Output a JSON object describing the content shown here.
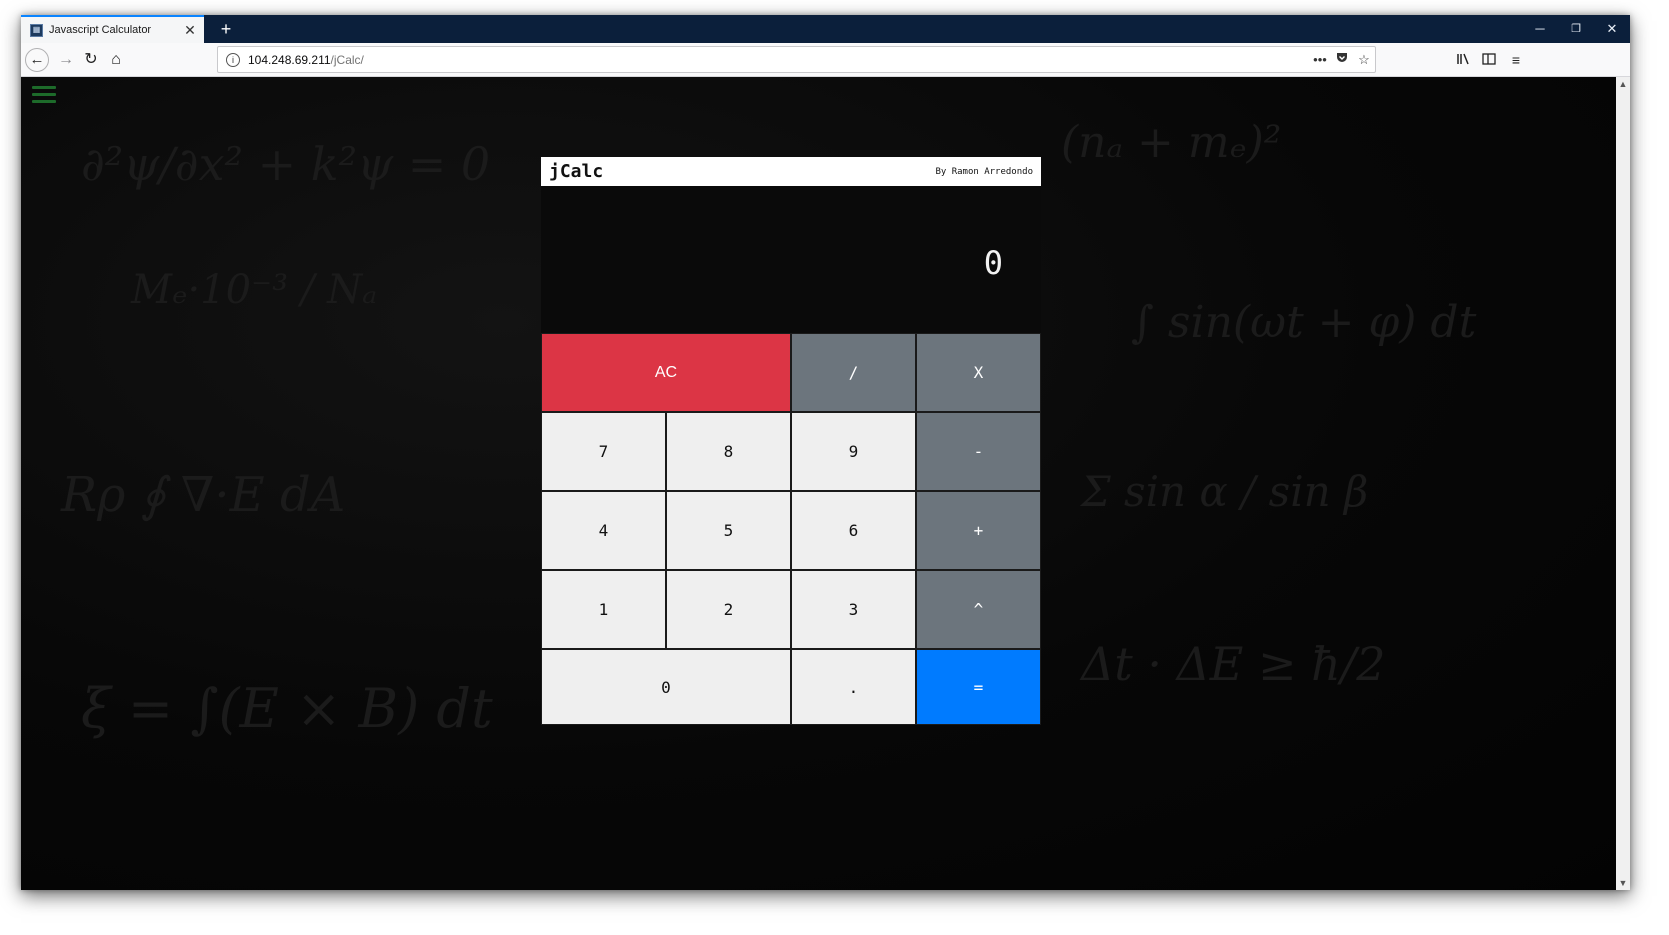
{
  "browser": {
    "tab_title": "Javascript Calculator",
    "tab_close": "✕",
    "new_tab": "+",
    "url_host": "104.248.69.211",
    "url_path": "/jCalc/",
    "more_actions": "•••",
    "window_minimize": "─",
    "window_restore": "❐",
    "window_close": "✕"
  },
  "calculator": {
    "title": "jCalc",
    "author": "By Ramon Arredondo",
    "display": "0",
    "keys": {
      "clear": "AC",
      "divide": "/",
      "multiply": "X",
      "seven": "7",
      "eight": "8",
      "nine": "9",
      "subtract": "-",
      "four": "4",
      "five": "5",
      "six": "6",
      "add": "+",
      "one": "1",
      "two": "2",
      "three": "3",
      "power": "^",
      "zero": "0",
      "decimal": ".",
      "equals": "="
    }
  },
  "colors": {
    "clear": "#dc3545",
    "operator": "#6c757d",
    "equals": "#007bff",
    "number": "#efefef",
    "menu_icon": "#1d6b2a"
  }
}
